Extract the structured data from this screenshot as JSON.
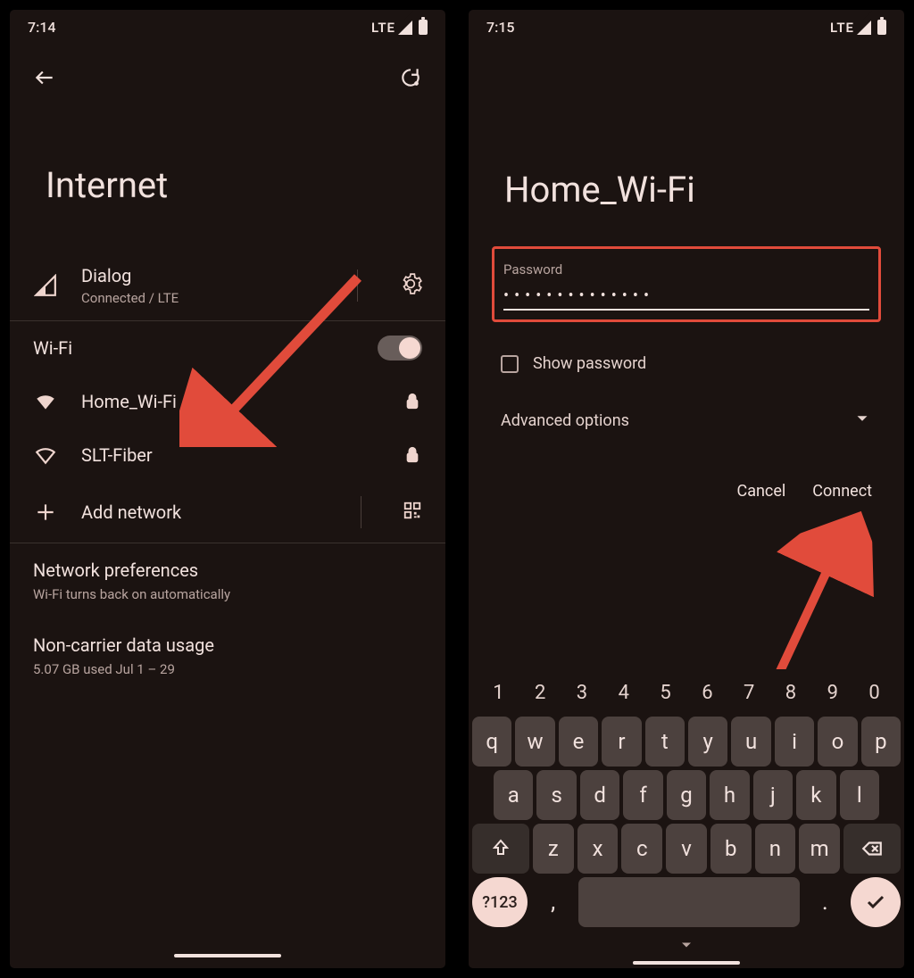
{
  "screen1": {
    "status": {
      "time": "7:14",
      "net": "LTE"
    },
    "title": "Internet",
    "carrier": {
      "name": "Dialog",
      "status": "Connected / LTE"
    },
    "wifi_header": "Wi-Fi",
    "networks": [
      {
        "ssid": "Home_Wi-Fi",
        "secured": true,
        "strong": true
      },
      {
        "ssid": "SLT-Fiber",
        "secured": true,
        "strong": false
      }
    ],
    "add_network": "Add network",
    "prefs": {
      "title": "Network preferences",
      "desc": "Wi-Fi turns back on automatically"
    },
    "usage": {
      "title": "Non-carrier data usage",
      "desc": "5.07 GB used Jul 1 – 29"
    }
  },
  "screen2": {
    "status": {
      "time": "7:15",
      "net": "LTE"
    },
    "ssid": "Home_Wi-Fi",
    "password_label": "Password",
    "password_value": "••••••••••••••",
    "show_password": "Show password",
    "advanced": "Advanced options",
    "actions": {
      "cancel": "Cancel",
      "connect": "Connect"
    },
    "keyboard": {
      "numbers": [
        "1",
        "2",
        "3",
        "4",
        "5",
        "6",
        "7",
        "8",
        "9",
        "0"
      ],
      "row1": [
        "q",
        "w",
        "e",
        "r",
        "t",
        "y",
        "u",
        "i",
        "o",
        "p"
      ],
      "row2": [
        "a",
        "s",
        "d",
        "f",
        "g",
        "h",
        "j",
        "k",
        "l"
      ],
      "row3": [
        "z",
        "x",
        "c",
        "v",
        "b",
        "n",
        "m"
      ],
      "symkey": "?123",
      "comma": ",",
      "period": "."
    }
  }
}
